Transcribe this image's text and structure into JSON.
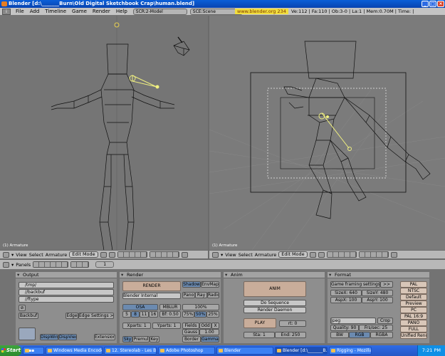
{
  "window": {
    "title": "Blender [d:\\_______Burn\\Old Digital Sketchbook Crap\\human.blend]"
  },
  "menubar": {
    "items": [
      "File",
      "Add",
      "Timeline",
      "Game",
      "Render",
      "Help"
    ],
    "screen": "SCR:2-Model",
    "scene": "SCE:Scene",
    "url": "www.blender.org 234",
    "stats": "Ve:112 | Fa:110 | Ob:3-0 | La:1 | Mem:0.70M | Time: |"
  },
  "viewports": {
    "left_label": "(1) Armature",
    "right_label": "(1) Armature"
  },
  "view_header": {
    "items": [
      "View",
      "Select",
      "Armature"
    ],
    "mode": "Edit Mode"
  },
  "buttons_header": {
    "panels": "Panels",
    "frame": "1"
  },
  "output_panel": {
    "title": "Output",
    "paths": [
      "/tmp/",
      "//backbuf",
      "//ftype"
    ],
    "backbuf": "Backbuf",
    "edge": "Edge",
    "edge_settings": "Edge Settings >>",
    "dispwin": "DispWin",
    "dispview": "DispView",
    "extension": "Extension"
  },
  "render_panel": {
    "title": "Render",
    "render": "RENDER",
    "engine": "Blender Internal",
    "shadow": "Shadow",
    "envmap": "EnvMap",
    "pano": "Pano",
    "ray": "Ray",
    "radio": "Radio",
    "osa": "OSA",
    "mblur": "MBLUR",
    "osa_levels": [
      "5",
      "8",
      "11",
      "16"
    ],
    "bf": "Bf: 0.50",
    "percent": "100%",
    "sizes": [
      "75%",
      "50%",
      "25%"
    ],
    "xparts": "Xparts: 1",
    "yparts": "Yparts: 1",
    "fields": "Fields",
    "odd": "Odd",
    "x": "X",
    "gauss": "Gauss",
    "gauss_val": "1.00",
    "sky": "Sky",
    "premul": "Premul",
    "key": "Key",
    "border": "Border",
    "gamma": "Gamma"
  },
  "anim_panel": {
    "title": "Anim",
    "anim": "ANIM",
    "do_sequence": "Do Sequence",
    "render_daemon": "Render Daemon",
    "play": "PLAY",
    "rt": "rt: 0",
    "sta": "Sta: 1",
    "end": "End: 250"
  },
  "format_panel": {
    "title": "Format",
    "game_framing": "Game framing settings",
    "game_framing_btn": ">>",
    "sizex": "SizeX: 640",
    "sizey": "SizeY: 480",
    "aspx": "AspX: 100",
    "aspy": "AspY: 100",
    "format": "Jpeg",
    "crop": "Crop",
    "quality": "Quality: 90",
    "frs": "Frs/sec: 25",
    "bw": "BW",
    "rgb": "RGB",
    "rgba": "RGBA",
    "presets": [
      "PAL",
      "NTSC",
      "Default",
      "Preview",
      "PC",
      "PAL 16:9",
      "PANO",
      "FULL",
      "Unified Rend"
    ]
  },
  "taskbar": {
    "start": "Start",
    "tasks": [
      "Windows Media Encoder 9",
      "12. Stereolab - Les Bos B...",
      "Adobe Photoshop",
      "Blender",
      "Blender [d:\\_______B...",
      "Rigging - Mozilla"
    ],
    "time": "7:21 PM"
  },
  "colors": {
    "viewport_bg": "#757575",
    "selection": "#f0f080",
    "header": "#b8b8b8"
  }
}
